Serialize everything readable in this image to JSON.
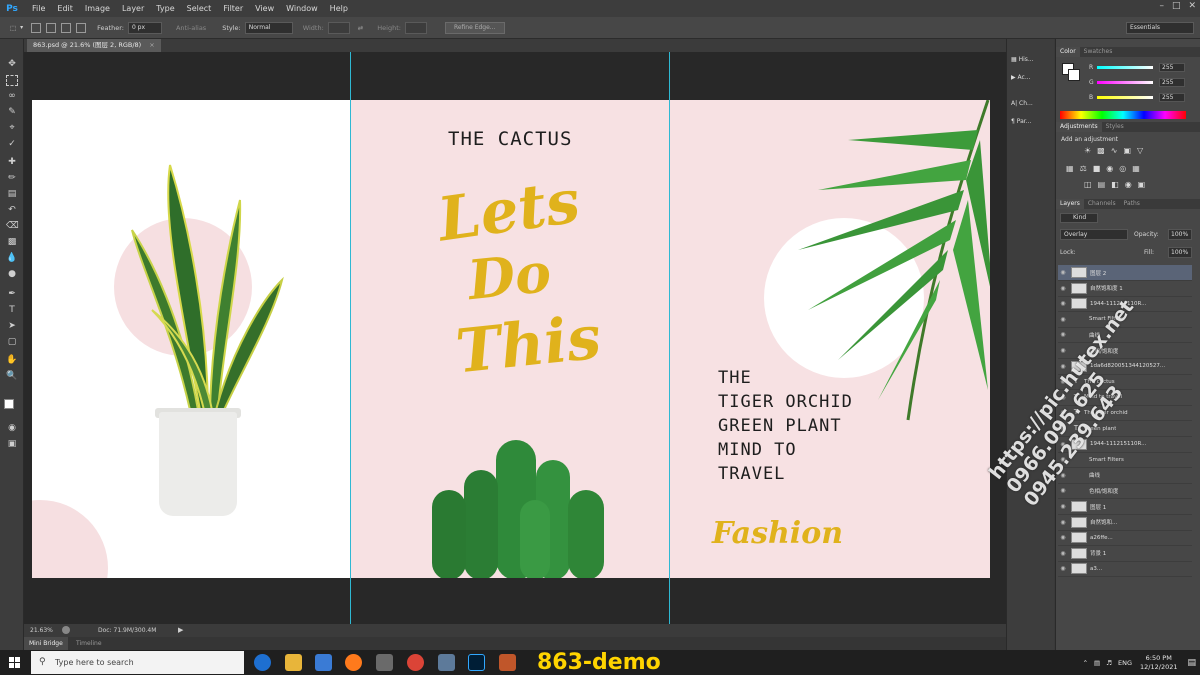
{
  "app": {
    "logo": "Ps"
  },
  "menu": [
    "File",
    "Edit",
    "Image",
    "Layer",
    "Type",
    "Select",
    "Filter",
    "View",
    "Window",
    "Help"
  ],
  "options_bar": {
    "feather_label": "Feather:",
    "feather_value": "0 px",
    "anti_alias": "Anti-alias",
    "style_label": "Style:",
    "style_value": "Normal",
    "width_label": "Width:",
    "height_label": "Height:",
    "refine_edge": "Refine Edge...",
    "workspace": "Essentials"
  },
  "document": {
    "tab_title": "863.psd @ 21.6% (图层 2, RGB/8)",
    "cactus_title": "THE CACTUS",
    "script_lines": [
      "Lets",
      "Do",
      "This"
    ],
    "right_text": [
      "THE",
      "TIGER ORCHID",
      "GREEN PLANT",
      "MIND TO",
      "TRAVEL"
    ],
    "fashion": "Fashion"
  },
  "status": {
    "zoom": "21.63%",
    "doc_size": "Doc: 71.9M/300.4M"
  },
  "bottom_tabs": [
    "Mini Bridge",
    "Timeline"
  ],
  "mini_panels": [
    "His...",
    "Ac...",
    "Ch...",
    "Par..."
  ],
  "color_panel": {
    "tabs": [
      "Color",
      "Swatches"
    ],
    "r_label": "R",
    "g_label": "G",
    "b_label": "B",
    "r": "255",
    "g": "255",
    "b": "255"
  },
  "adjustments_panel": {
    "tabs": [
      "Adjustments",
      "Styles"
    ],
    "add_label": "Add an adjustment"
  },
  "layers_panel": {
    "tabs": [
      "Layers",
      "Channels",
      "Paths"
    ],
    "kind": "Kind",
    "blend_mode": "Overlay",
    "opacity_label": "Opacity:",
    "opacity": "100%",
    "lock_label": "Lock:",
    "fill_label": "Fill:",
    "fill": "100%",
    "layers": [
      "图层 2",
      "自然饱和度 1",
      "1944-111215110R...",
      "Smart Filters",
      "曲线",
      "色相/饱和度",
      "1da6d820051344120527...",
      "THE cactus",
      "Mind to travel",
      "The tiger orchid",
      "Green plant",
      "1944-111215110R...",
      "Smart Filters",
      "曲线",
      "色相/饱和度",
      "图层 1",
      "自然饱和...",
      "a26ffe...",
      "背景 1",
      "a3..."
    ]
  },
  "taskbar": {
    "search_placeholder": "Type here to search",
    "demo_label": "863-demo",
    "language": "ENG",
    "time": "6:50 PM",
    "date": "12/12/2021"
  },
  "watermark": [
    "https://pic.hutex.net",
    "0966.095.625",
    "0945.239.643"
  ],
  "colors": {
    "accent": "#31a8ff",
    "pink_bg": "#f7e1e3",
    "gold": "#e0b21c",
    "guide": "#2fb8d3",
    "demo_yellow": "#ffd400"
  }
}
